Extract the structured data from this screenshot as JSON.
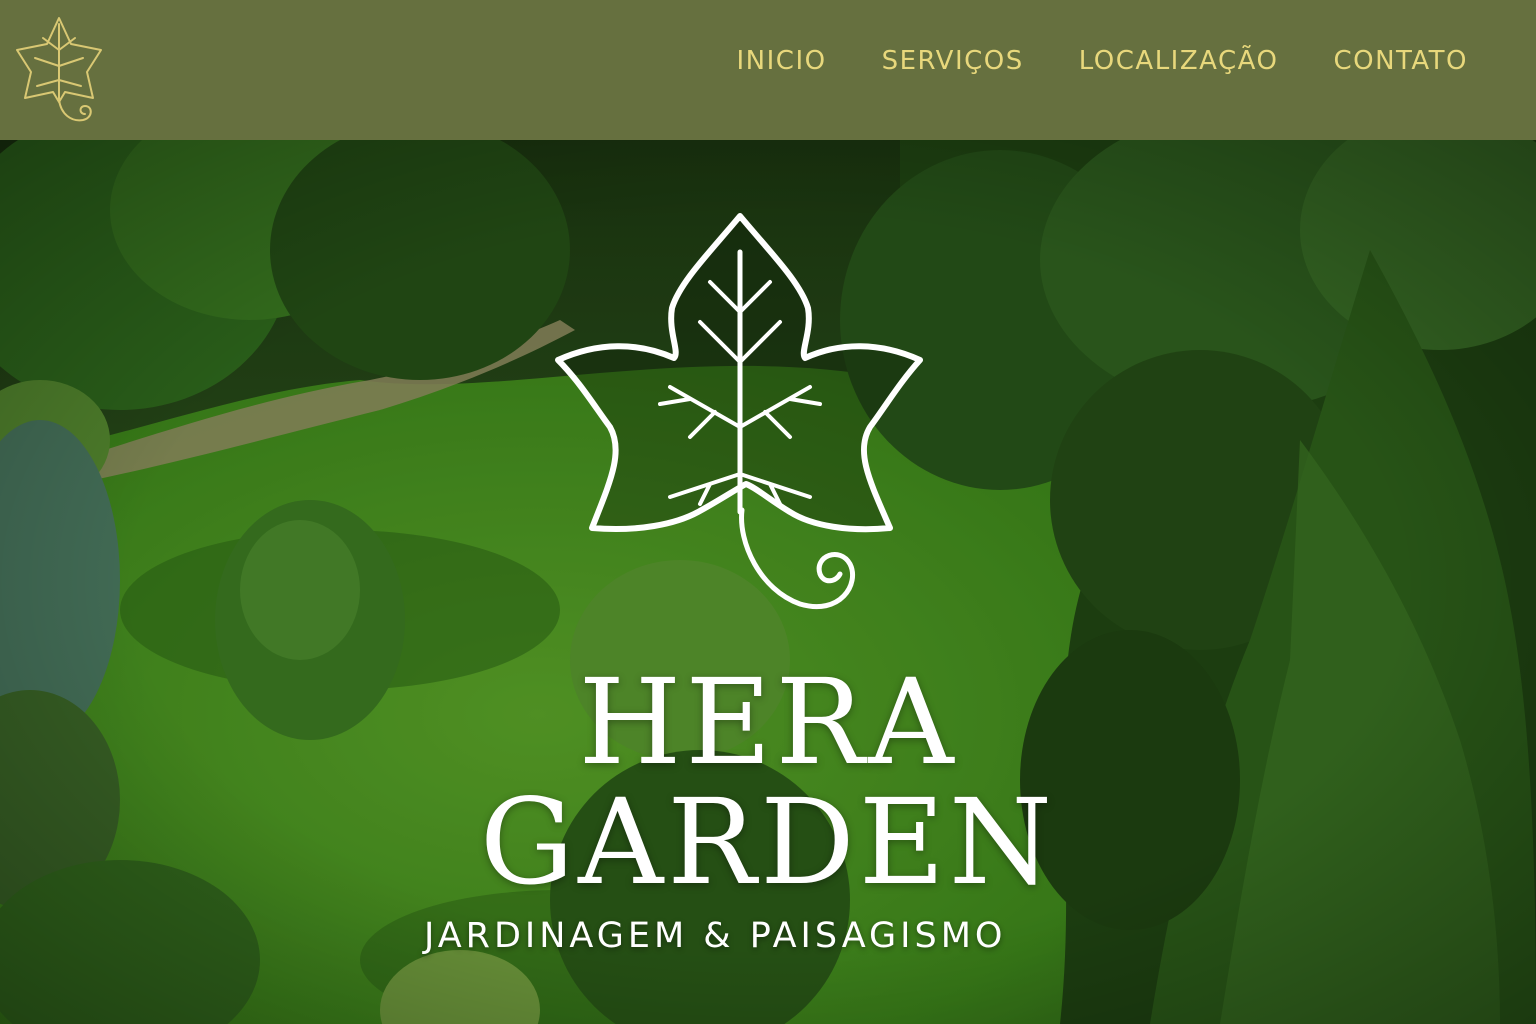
{
  "nav": {
    "logo_icon": "ivy-leaf-icon",
    "items": [
      {
        "label": "INICIO"
      },
      {
        "label": "SERVIÇOS"
      },
      {
        "label": "LOCALIZAÇÃO"
      },
      {
        "label": "CONTATO"
      }
    ]
  },
  "hero": {
    "logo_icon": "ivy-leaf-icon",
    "title_line1": "HERA",
    "title_line2": "GARDEN",
    "tagline": "JARDINAGEM & PAISAGISMO"
  },
  "colors": {
    "nav_background": "#66703f",
    "nav_text": "#e8d87c",
    "hero_text": "#ffffff"
  }
}
